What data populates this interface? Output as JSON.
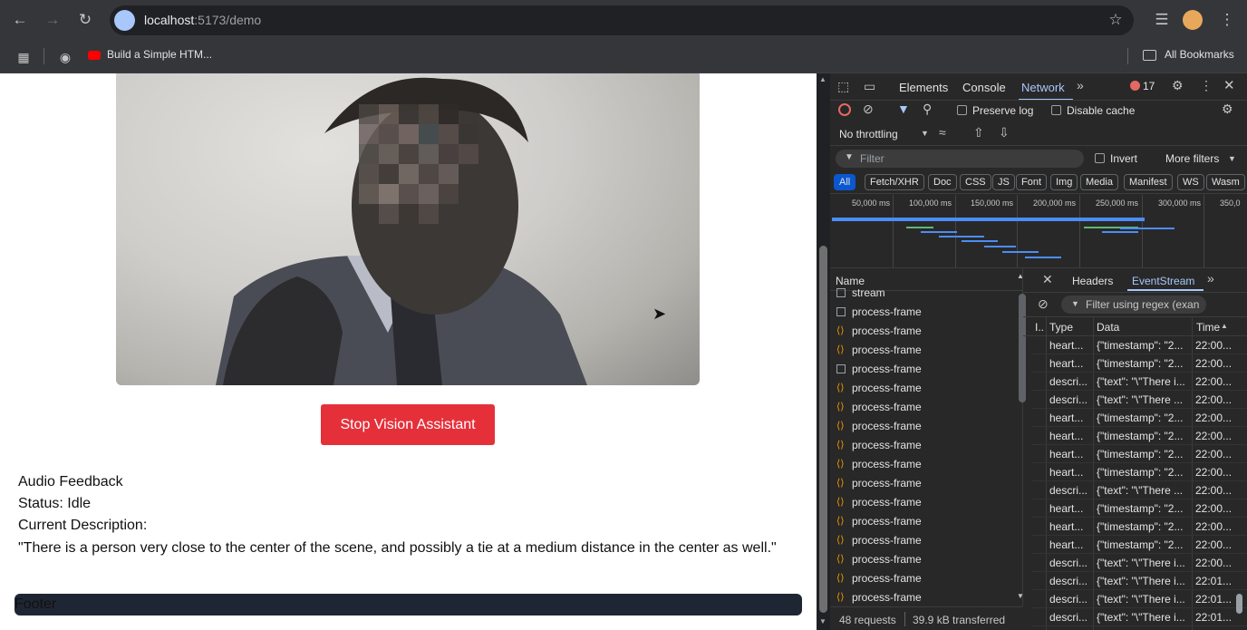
{
  "browser": {
    "url_host": "localhost",
    "url_rest": ":5173/demo",
    "bookmarks": [
      {
        "label": "Build a Simple HTM..."
      }
    ],
    "all_bookmarks_label": "All Bookmarks"
  },
  "page": {
    "stop_button_label": "Stop Vision Assistant",
    "audio_feedback_label": "Audio Feedback",
    "status_label": "Status: Idle",
    "current_description_label": "Current Description:",
    "description_text": "\"There is a person very close to the center of the scene, and possibly a tie at a medium distance in the center as well.\"",
    "footer_label": "Footer"
  },
  "devtools": {
    "tabs": [
      "Elements",
      "Console",
      "Network"
    ],
    "active_tab": "Network",
    "error_count": "17",
    "preserve_log_label": "Preserve log",
    "disable_cache_label": "Disable cache",
    "throttling_label": "No throttling",
    "filter_placeholder": "Filter",
    "invert_label": "Invert",
    "more_filters_label": "More filters",
    "type_filters": [
      "All",
      "Fetch/XHR",
      "Doc",
      "CSS",
      "JS",
      "Font",
      "Img",
      "Media",
      "Manifest",
      "WS",
      "Wasm"
    ],
    "timeline_ticks": [
      "50,000 ms",
      "100,000 ms",
      "150,000 ms",
      "200,000 ms",
      "250,000 ms",
      "300,000 ms",
      "350,0"
    ],
    "name_header": "Name",
    "requests": [
      {
        "name": "stream",
        "icon": "checkbox-icon"
      },
      {
        "name": "process-frame",
        "icon": "checkbox-icon"
      },
      {
        "name": "process-frame",
        "icon": "fetch-icon"
      },
      {
        "name": "process-frame",
        "icon": "fetch-icon"
      },
      {
        "name": "process-frame",
        "icon": "checkbox-icon"
      },
      {
        "name": "process-frame",
        "icon": "fetch-icon"
      },
      {
        "name": "process-frame",
        "icon": "fetch-icon"
      },
      {
        "name": "process-frame",
        "icon": "fetch-icon"
      },
      {
        "name": "process-frame",
        "icon": "fetch-icon"
      },
      {
        "name": "process-frame",
        "icon": "fetch-icon"
      },
      {
        "name": "process-frame",
        "icon": "fetch-icon"
      },
      {
        "name": "process-frame",
        "icon": "fetch-icon"
      },
      {
        "name": "process-frame",
        "icon": "fetch-icon"
      },
      {
        "name": "process-frame",
        "icon": "fetch-icon"
      },
      {
        "name": "process-frame",
        "icon": "fetch-icon"
      },
      {
        "name": "process-frame",
        "icon": "fetch-icon"
      },
      {
        "name": "process-frame",
        "icon": "fetch-icon"
      }
    ],
    "detail_tabs": [
      "Headers",
      "EventStream"
    ],
    "active_detail_tab": "EventStream",
    "regex_placeholder": "Filter using regex (exan",
    "event_columns": [
      "I..",
      "Type",
      "Data",
      "Time"
    ],
    "events": [
      {
        "type": "heart...",
        "data": "{\"timestamp\": \"2...",
        "time": "22:00..."
      },
      {
        "type": "heart...",
        "data": "{\"timestamp\": \"2...",
        "time": "22:00..."
      },
      {
        "type": "descri...",
        "data": "{\"text\": \"\\\"There i...",
        "time": "22:00..."
      },
      {
        "type": "descri...",
        "data": "{\"text\": \"\\\"There ...",
        "time": "22:00..."
      },
      {
        "type": "heart...",
        "data": "{\"timestamp\": \"2...",
        "time": "22:00..."
      },
      {
        "type": "heart...",
        "data": "{\"timestamp\": \"2...",
        "time": "22:00..."
      },
      {
        "type": "heart...",
        "data": "{\"timestamp\": \"2...",
        "time": "22:00..."
      },
      {
        "type": "heart...",
        "data": "{\"timestamp\": \"2...",
        "time": "22:00..."
      },
      {
        "type": "descri...",
        "data": "{\"text\": \"\\\"There ...",
        "time": "22:00..."
      },
      {
        "type": "heart...",
        "data": "{\"timestamp\": \"2...",
        "time": "22:00..."
      },
      {
        "type": "heart...",
        "data": "{\"timestamp\": \"2...",
        "time": "22:00..."
      },
      {
        "type": "heart...",
        "data": "{\"timestamp\": \"2...",
        "time": "22:00..."
      },
      {
        "type": "descri...",
        "data": "{\"text\": \"\\\"There i...",
        "time": "22:00..."
      },
      {
        "type": "descri...",
        "data": "{\"text\": \"\\\"There i...",
        "time": "22:01..."
      },
      {
        "type": "descri...",
        "data": "{\"text\": \"\\\"There i...",
        "time": "22:01..."
      },
      {
        "type": "descri...",
        "data": "{\"text\": \"\\\"There i...",
        "time": "22:01..."
      }
    ],
    "status_requests": "48 requests",
    "status_transferred": "39.9 kB transferred"
  },
  "colors": {
    "accent_blue": "#a8c7fa",
    "stop_red": "#e5303a",
    "footer_bg": "#1f2633"
  }
}
